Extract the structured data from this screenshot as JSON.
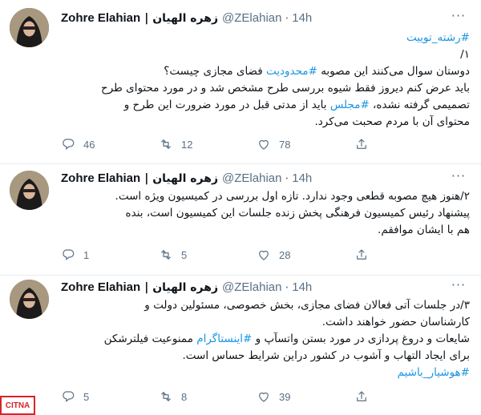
{
  "tweets": [
    {
      "name": "Zohre Elahian",
      "name_fa": "| زهره الهیان",
      "handle": "@ZElahian",
      "time": "14h",
      "lines": [
        [
          {
            "t": "#رشته_توییت",
            "link": true
          }
        ],
        [
          {
            "t": "۱/",
            "link": false
          }
        ],
        [
          {
            "t": "دوستان سوال می‌کنند این مصوبه ",
            "link": false
          },
          {
            "t": "#محدودیت",
            "link": true
          },
          {
            "t": "  فضای مجازی چیست؟",
            "link": false
          }
        ],
        [
          {
            "t": "باید عرض کنم دیروز فقط شیوه بررسی طرح مشخص شد و در مورد محتوای طرح",
            "link": false
          }
        ],
        [
          {
            "t": "تصمیمی گرفته نشده، ",
            "link": false
          },
          {
            "t": "#مجلس",
            "link": true
          },
          {
            "t": " باید از مدتی قبل در مورد ضرورت این طرح و",
            "link": false
          }
        ],
        [
          {
            "t": "محتوای آن با مردم صحبت می‌کرد.",
            "link": false
          }
        ]
      ],
      "replies": "46",
      "retweets": "12",
      "likes": "78"
    },
    {
      "name": "Zohre Elahian",
      "name_fa": "| زهره الهیان",
      "handle": "@ZElahian",
      "time": "14h",
      "lines": [
        [
          {
            "t": "۲/هنوز هیچ مصوبه قطعی وجود ندارد. تازه اول بررسی در کمیسیون ویژه است.",
            "link": false
          }
        ],
        [
          {
            "t": "پیشنهاد رئیس کمیسیون فرهنگی  پخش زنده جلسات این کمیسیون است، بنده",
            "link": false
          }
        ],
        [
          {
            "t": "هم با ایشان موافقم.",
            "link": false
          }
        ]
      ],
      "replies": "1",
      "retweets": "5",
      "likes": "28"
    },
    {
      "name": "Zohre Elahian",
      "name_fa": "| زهره الهیان",
      "handle": "@ZElahian",
      "time": "14h",
      "lines": [
        [
          {
            "t": "۳/در جلسات آتی فعالان فضای مجازی، بخش خصوصی، مسئولین دولت و",
            "link": false
          }
        ],
        [
          {
            "t": "کارشناسان حضور خواهند داشت.",
            "link": false
          }
        ],
        [
          {
            "t": "شایعات و دروغ پردازی در مورد بستن واتسآپ و ",
            "link": false
          },
          {
            "t": "#اینستاگرام",
            "link": true
          },
          {
            "t": " ممنوعیت فیلترشکن",
            "link": false
          }
        ],
        [
          {
            "t": "برای ایجاد التهاب و آشوب در کشور دراین شرایط حساس است.",
            "link": false
          }
        ],
        [
          {
            "t": "#هوشیار_باشیم",
            "link": true
          }
        ]
      ],
      "replies": "5",
      "retweets": "8",
      "likes": "39"
    }
  ],
  "icons": {
    "more": "more-options-icon",
    "reply": "reply-icon",
    "retweet": "retweet-icon",
    "like": "heart-icon",
    "share": "share-icon"
  },
  "watermark": "CITNA",
  "colors": {
    "link": "#1b95e0",
    "muted": "#5b7083",
    "divider": "#e6ecf0"
  }
}
